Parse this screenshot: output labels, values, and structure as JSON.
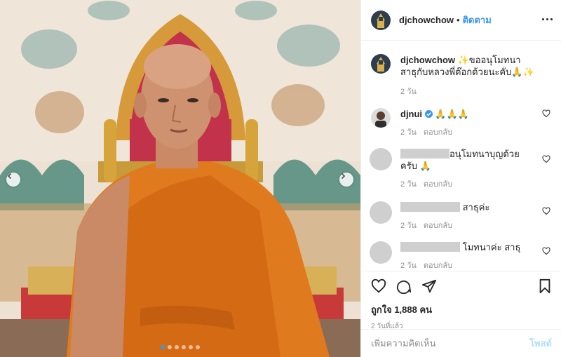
{
  "post": {
    "username": "djchowchow",
    "follow_label": "ติดตาม",
    "separator": "•",
    "caption": "✨ขออนุโมทนาสาธุกับหลวงพี่ต๊อกด้วยนะคับ🙏✨",
    "caption_time": "2 วัน",
    "likes_label": "ถูกใจ 1,888 คน",
    "posted_ago": "2 วันที่แล้ว",
    "carousel": {
      "total": 6,
      "active_index": 0
    }
  },
  "comments": [
    {
      "username": "djnui",
      "verified": true,
      "text": "🙏🙏🙏",
      "time": "2 วัน",
      "reply": "ตอบกลับ"
    },
    {
      "username": "",
      "redacted": true,
      "text": "อนุโมทนาบุญด้วยครับ 🙏",
      "time": "2 วัน",
      "reply": "ตอบกลับ"
    },
    {
      "username": "",
      "redacted": true,
      "text": "สาธุค่ะ",
      "time": "2 วัน",
      "reply": "ตอบกลับ"
    },
    {
      "username": "",
      "redacted": true,
      "text": "โมทนาค่ะ สาธุ",
      "time": "2 วัน",
      "reply": "ตอบกลับ"
    }
  ],
  "composer": {
    "placeholder": "เพิ่มความคิดเห็น",
    "post_label": "โพสต์"
  },
  "icons": {
    "like": "heart-icon",
    "comment": "comment-icon",
    "share": "paper-plane-icon",
    "save": "bookmark-icon",
    "more": "more-options-icon",
    "verified": "verified-badge-icon"
  },
  "colors": {
    "link": "#3897f0",
    "muted": "#8e8e8e",
    "robe": "#e07a1f",
    "post_disabled": "#b2dffc"
  }
}
